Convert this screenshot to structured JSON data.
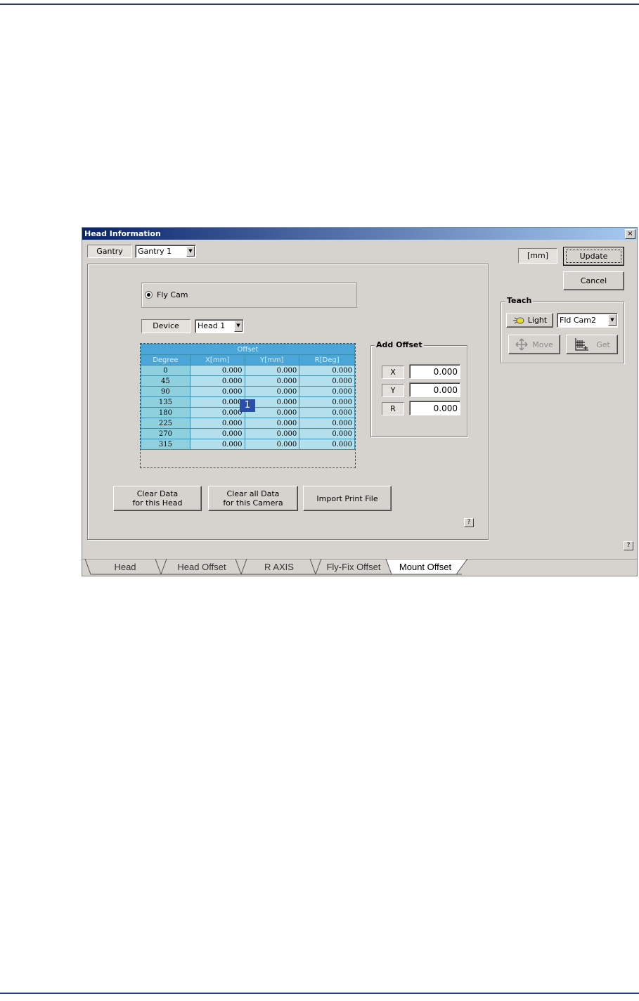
{
  "window": {
    "title": "Head Information",
    "close": "×"
  },
  "gantry": {
    "label": "Gantry",
    "value": "Gantry 1"
  },
  "unit": "[mm]",
  "buttons": {
    "update": "Update",
    "cancel": "Cancel",
    "clear_head": [
      "Clear Data",
      "for this Head"
    ],
    "clear_camera": [
      "Clear all Data",
      "for this Camera"
    ],
    "import": "Import Print File"
  },
  "camera_radio": "Fly Cam",
  "device": {
    "label": "Device",
    "value": "Head 1"
  },
  "offset_table": {
    "title": "Offset",
    "columns": [
      "Degree",
      "X[mm]",
      "Y[mm]",
      "R[Deg]"
    ],
    "rows": [
      [
        "0",
        "0.000",
        "0.000",
        "0.000"
      ],
      [
        "45",
        "0.000",
        "0.000",
        "0.000"
      ],
      [
        "90",
        "0.000",
        "0.000",
        "0.000"
      ],
      [
        "135",
        "0.000",
        "0.000",
        "0.000"
      ],
      [
        "180",
        "0.000",
        "0.000",
        "0.000"
      ],
      [
        "225",
        "0.000",
        "0.000",
        "0.000"
      ],
      [
        "270",
        "0.000",
        "0.000",
        "0.000"
      ],
      [
        "315",
        "0.000",
        "0.000",
        "0.000"
      ]
    ],
    "callout": "1"
  },
  "add_offset": {
    "title": "Add Offset",
    "fields": [
      {
        "label": "X",
        "value": "0.000"
      },
      {
        "label": "Y",
        "value": "0.000"
      },
      {
        "label": "R",
        "value": "0.000"
      }
    ]
  },
  "teach": {
    "title": "Teach",
    "light": "Light",
    "camera": "Fld Cam2",
    "move": "Move",
    "get": "Get"
  },
  "help": "?",
  "tabs": [
    "Head",
    "Head Offset",
    "R AXIS",
    "Fly-Fix Offset",
    "Mount Offset"
  ],
  "active_tab": "Mount Offset",
  "colors": {
    "title_start": "#0a246a",
    "table_header": "#4aa6d8",
    "table_cell": "#b4e0ee",
    "callout": "#2b4fa8"
  }
}
